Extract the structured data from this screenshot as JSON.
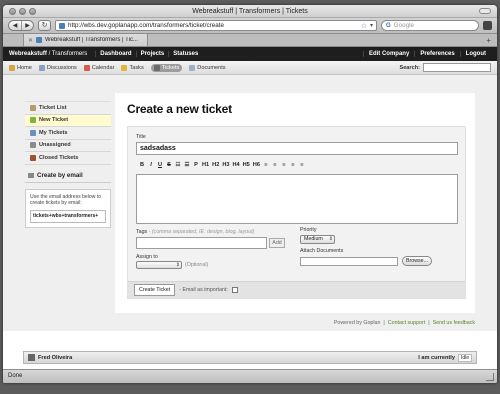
{
  "browser": {
    "window_title": "Webreakstuff | Transformers | Tickets",
    "url": "http://wbs.dev.goplanapp.com/transformers/ticket/create",
    "search_placeholder": "Google",
    "tab_title": "Webreakstuff | Transformers | Tic...",
    "back_glyph": "◀",
    "forward_glyph": "▶",
    "reload_glyph": "↻",
    "new_tab_glyph": "+",
    "status_text": "Done"
  },
  "app_header": {
    "brand": "Webreakstuff",
    "brand_sub": " / Transformers",
    "nav": [
      "Dashboard",
      "Projects",
      "Statuses"
    ],
    "right_nav": [
      "Edit Company",
      "Preferences",
      "Logout"
    ]
  },
  "subnav": {
    "items": [
      {
        "label": "Home",
        "icon": "home-icon",
        "color": "#d9a441"
      },
      {
        "label": "Discussions",
        "icon": "discussions-icon",
        "color": "#8aa0c2"
      },
      {
        "label": "Calendar",
        "icon": "calendar-icon",
        "color": "#d55c4a"
      },
      {
        "label": "Tasks",
        "icon": "tasks-icon",
        "color": "#e6b43a"
      },
      {
        "label": "Tickets",
        "icon": "tickets-icon",
        "color": "#6a6a6a"
      },
      {
        "label": "Documents",
        "icon": "documents-icon",
        "color": "#9bb1c7"
      }
    ],
    "search_label": "Search:"
  },
  "sidebar": {
    "items": [
      {
        "label": "Ticket List",
        "icon": "ticket-list-icon",
        "color": "#b59b6a"
      },
      {
        "label": "New Ticket",
        "icon": "new-ticket-icon",
        "color": "#7fb24a"
      },
      {
        "label": "My Tickets",
        "icon": "my-tickets-icon",
        "color": "#6b8fbf"
      },
      {
        "label": "Unassigned",
        "icon": "unassigned-icon",
        "color": "#8c8c8c"
      },
      {
        "label": "Closed Tickets",
        "icon": "closed-tickets-icon",
        "color": "#a0522d"
      }
    ],
    "by_email_title": "Create by email",
    "email_help": "Use the email address below to create tickets by email:",
    "email_address": "tickets+wbs+transformers+"
  },
  "form": {
    "heading": "Create a new ticket",
    "title_label": "Title",
    "title_value": "sadsadass",
    "toolbar": [
      "B",
      "I",
      "U",
      "S",
      "☷",
      "☰",
      "P",
      "H1",
      "H2",
      "H3",
      "H4",
      "H5",
      "H6",
      "≡",
      "≡",
      "≡",
      "≡",
      "≡"
    ],
    "tags_label": "Tags",
    "tags_hint": " - (comma separated, IE: design, blog, layout)",
    "add_button": "Add",
    "assign_label": "Assign to",
    "assign_value": "",
    "assign_optional": "(Optional)",
    "priority_label": "Priority",
    "priority_value": "Medium",
    "attach_label": "Attach Documents",
    "browse_button": "Browse...",
    "create_button": "Create Ticket",
    "email_important_label": "- Email as important:"
  },
  "footer": {
    "powered_by": "Powered by Goplan",
    "sep": "|",
    "contact": "Contact support",
    "feedback": "Send us feedback"
  },
  "userbar": {
    "name": "Fred Oliveira",
    "current_label": "I am currently",
    "status": "Idle"
  }
}
